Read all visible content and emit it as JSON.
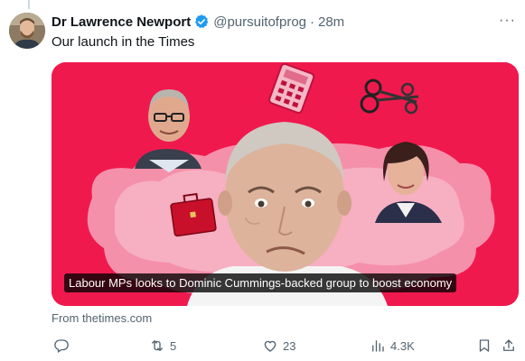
{
  "tweet": {
    "author_name": "Dr Lawrence Newport",
    "handle": "@pursuitofprog",
    "separator": "·",
    "time": "28m",
    "text": "Our launch in the Times",
    "more_label": "···"
  },
  "card": {
    "caption": "Labour MPs looks to Dominic Cummings-backed group to boost economy",
    "source": "From thetimes.com"
  },
  "actions": {
    "retweets": "5",
    "likes": "23",
    "views": "4.3K"
  },
  "colors": {
    "card_background": "#f0194e",
    "verified": "#1d9bf0",
    "secondary_text": "#536471"
  }
}
